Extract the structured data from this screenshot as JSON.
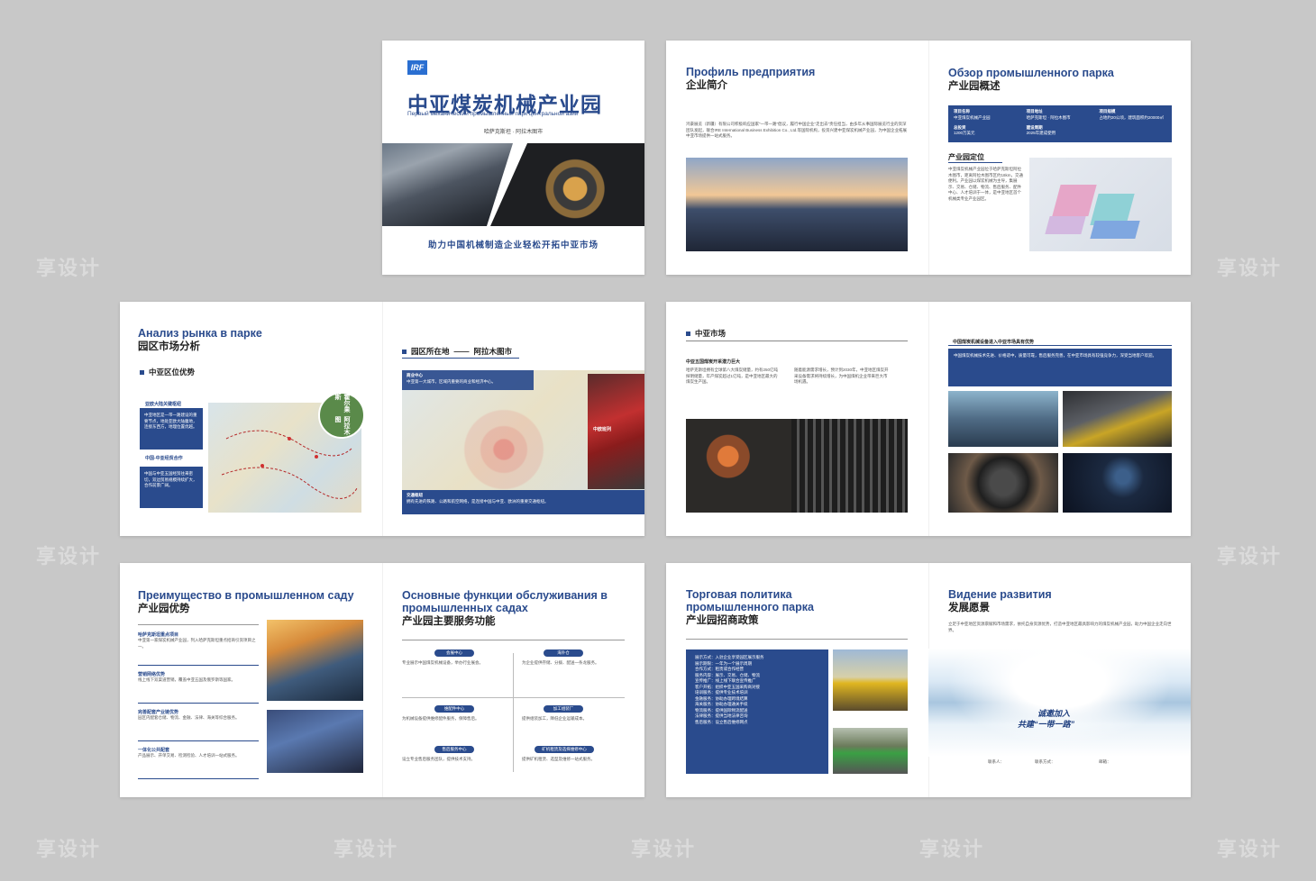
{
  "page1": {
    "logo": "IRF",
    "title": "中亚煤炭机械产业园",
    "subtitle": "Первый механический промышленный парк центральной азии",
    "location": "哈萨克斯坦 · 阿拉木图市",
    "slogan": "助力中国机械制造企业轻松开拓中亚市场"
  },
  "page2": {
    "ru": "Профиль предприятия",
    "cn": "企业简介",
    "body": "鸿豪展览（新疆）有限公司积极响应国家“一带一路”倡议，履行中国企业“走出去”责任担当，由多年从事国际展览行业的资深团队发起，联合IRE International Business Exhibition Co., Ltd.等国际机构，投资兴建中亚煤炭机械产业园，为中国企业拓展中亚市场提供一站式服务。"
  },
  "page3": {
    "ru": "Обзор промышленного парка",
    "cn": "产业园概述",
    "info": [
      {
        "k": "项目名称",
        "v": "中亚煤炭机械产业园"
      },
      {
        "k": "项目地址",
        "v": "哈萨克斯坦 · 阿拉木图市"
      },
      {
        "k": "项目规模",
        "v": "占地约20公顷，建筑面积约20000㎡"
      },
      {
        "k": "总投资",
        "v": "1200万美元"
      },
      {
        "k": "建设周期",
        "v": "2025年建成使用"
      }
    ],
    "loc_title": "产业园定位",
    "loc_body": "中亚煤炭机械产业园位于哈萨克斯坦阿拉木图市，距离阿拉木图市区约18km，交通便利。产业园以煤炭机械为主导，集展示、交易、仓储、物流、售后服务、配件中心、人才培训于一体，是中亚地区首个机械类专业产业园区。"
  },
  "page4": {
    "ru": "Анализ рынка в парке",
    "cn": "园区市场分析",
    "sec": "中亚区位优势",
    "item1_title": "亚欧大陆关键枢纽",
    "item1_body": "中亚地区是一带一路建设的重要节点，地处亚欧大陆腹地，连接东西方，地理位置优越。",
    "item2_title": "中国-中亚经贸合作",
    "item2_body": "中国与中亚五国经贸往来密切，双边贸易规模持续扩大，合作前景广阔。",
    "map_label_1": "霍尔果斯",
    "map_label_2": "阿拉木图"
  },
  "page5": {
    "sec": "园区所在地",
    "sec2": "阿拉木图市",
    "box1_title": "商业中心",
    "box1_body": "中亚第一大城市，区域内重要的商业和经济中心。",
    "box2_title": "交通枢纽",
    "box2_body": "拥有先进的铁路、公路和航空网络，是连接中国与中亚、欧洲的重要交通枢纽。",
    "train_label": "中欧班列"
  },
  "page6": {
    "sec": "中亚市场",
    "sub": "中亚五国煤炭开采潜力巨大",
    "col1": "哈萨克斯坦拥有全球第八大煤炭储量，约有250亿吨探明储量，年产煤炭超过1亿吨，是中亚地区最大的煤炭生产国。",
    "col2": "随着能源需求增长，预计到2030年，中亚地区煤炭开采设备需求将持续增长，为中国煤机企业带来巨大市场机遇。"
  },
  "page7": {
    "sub": "中国煤炭机械设备进入中亚市场具有优势",
    "box_body": "中国煤炭机械技术先进、价格适中，质量可靠，售后服务完善，在中亚市场具有较强竞争力，深受当地客户欢迎。"
  },
  "page8": {
    "ru": "Преимущество в промышленном саду",
    "cn": "产业园优势",
    "items": [
      {
        "t": "哈萨克斯坦重点项目",
        "b": "中亚第一家煤炭机械产业园，列入哈萨克斯坦重点招商引资项目之一。"
      },
      {
        "t": "营销网络优势",
        "b": "线上线下双渠道营销，覆盖中亚五国及俄罗斯等国家。"
      },
      {
        "t": "完善配套产业链优势",
        "b": "园区内配套仓储、物流、金融、法律、海关等综合服务。"
      },
      {
        "t": "一体化公共配套",
        "b": "产品展示、开单交易、检测检验、人才培训一站式服务。"
      }
    ]
  },
  "page9": {
    "ru": "Основные функции обслуживания в промышленных садах",
    "cn": "产业园主要服务功能",
    "funcs": [
      {
        "t": "会展中心",
        "b": "专业展示中国煤炭机械设备，举办行业展会。"
      },
      {
        "t": "海外仓",
        "b": "为企业提供存储、分拨、配送一条龙服务。"
      },
      {
        "t": "维配件中心",
        "b": "为机械设备提供维修配件服务，保障售后。"
      },
      {
        "t": "加工组装厂",
        "b": "提供组装加工，降低企业运输成本。"
      },
      {
        "t": "售后服务中心",
        "b": "设立专业售后服务团队，提供技术支持。"
      },
      {
        "t": "矿机租赁及选择维修中心",
        "b": "提供矿机租赁、选型及维修一站式服务。"
      }
    ]
  },
  "page10": {
    "ru1": "Торговая политика",
    "ru2": "промышленного парка",
    "cn": "产业园招商政策",
    "policies": [
      "展示方式：入驻企业享受园区展示服务",
      "展示期限：一年为一个展示周期",
      "合作方式：租赁或合作经营",
      "服务内容：展示、交易、仓储、物流",
      "宣传推广：线上线下联合宣传推广",
      "客户开拓：组织中亚五国采购商对接",
      "培训服务：提供专业技术培训",
      "金融服务：协助办理跨境结算",
      "海关服务：协助办理通关手续",
      "物流服务：提供国际物流配送",
      "法律服务：提供当地法律咨询",
      "售后服务：设立售后维修网点"
    ]
  },
  "page11": {
    "ru": "Видение развития",
    "cn": "发展愿景",
    "body": "立足于中亚地区资源禀赋和市场需求，依托自身资源优势，打造中亚地区最具影响力的煤炭机械产业园，助力中国企业走向世界。",
    "invite1": "诚邀加入",
    "invite2": "共建“一带一路”",
    "contact1": "联系人：",
    "contact2": "联系方式：",
    "contact3": "邮箱："
  },
  "watermark": "享设计"
}
